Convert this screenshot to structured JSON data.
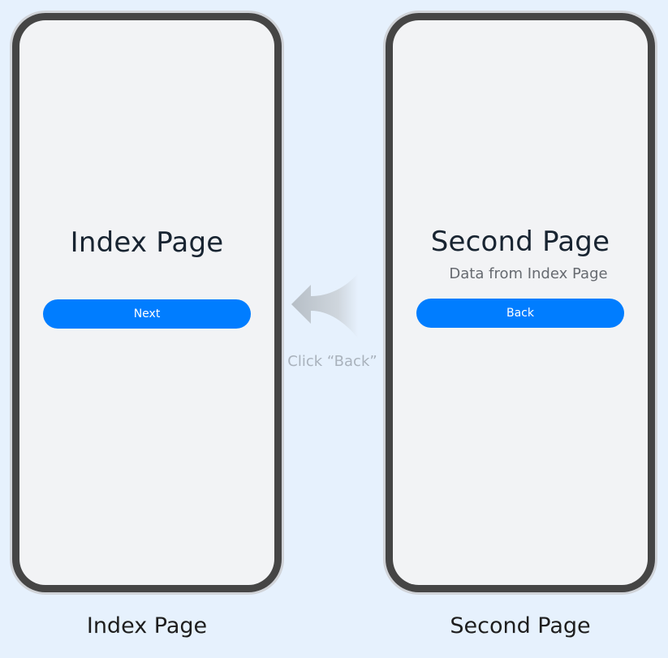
{
  "index_page": {
    "title": "Index Page",
    "next_label": "Next",
    "caption": "Index Page"
  },
  "second_page": {
    "title": "Second Page",
    "subtitle": "Data from Index Page",
    "back_label": "Back",
    "caption": "Second Page"
  },
  "transition": {
    "caption": "Click “Back”",
    "arrow_icon": "curved-arrow-left-icon"
  },
  "colors": {
    "background": "#e6f1fd",
    "button": "#007dff",
    "screen": "#f2f3f5",
    "bezel": "#454545"
  }
}
